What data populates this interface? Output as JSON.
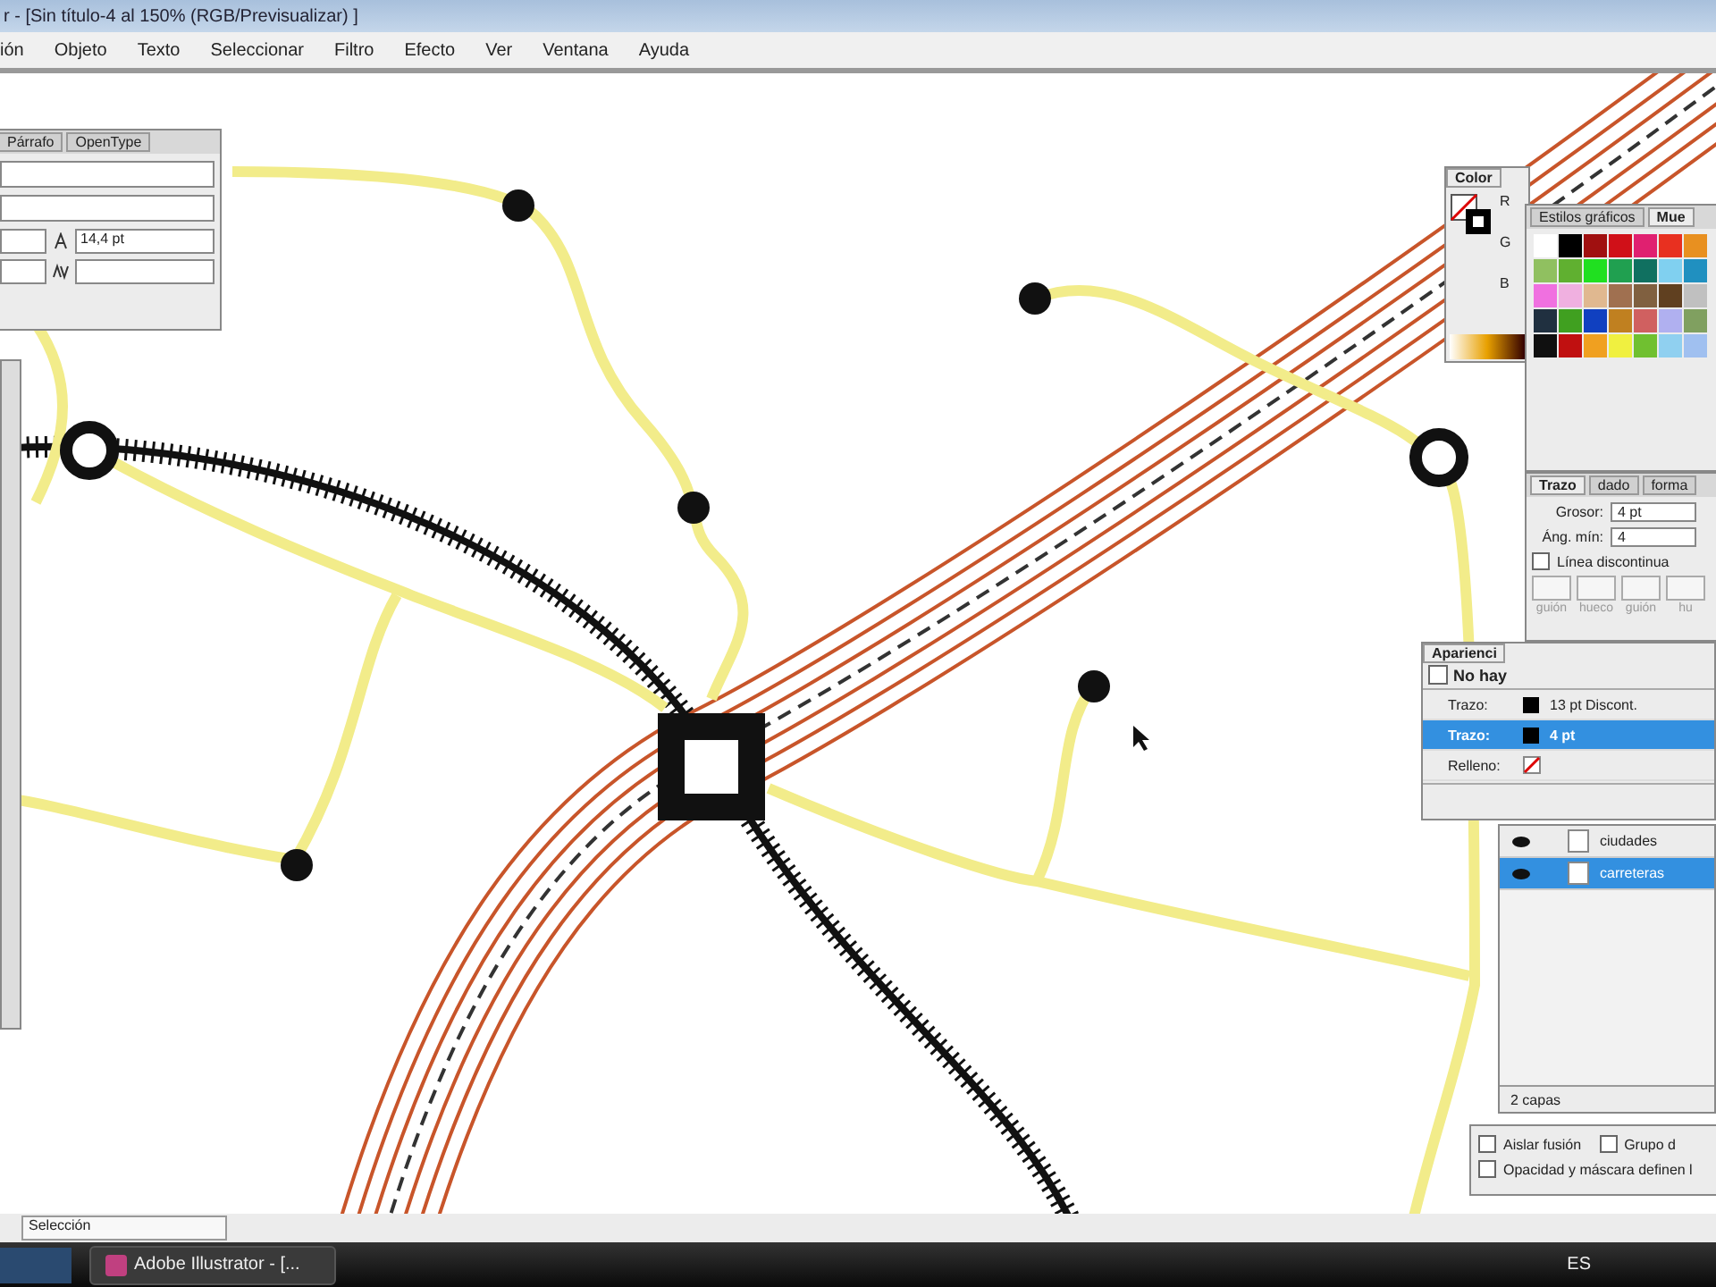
{
  "window": {
    "title": "r - [Sin título-4 al 150% (RGB/Previsualizar) ]"
  },
  "menu": [
    "ión",
    "Objeto",
    "Texto",
    "Seleccionar",
    "Filtro",
    "Efecto",
    "Ver",
    "Ventana",
    "Ayuda"
  ],
  "character_panel": {
    "tabs": [
      {
        "label": "Párrafo",
        "selected": false
      },
      {
        "label": "OpenType",
        "selected": false
      }
    ],
    "leading": "14,4 pt"
  },
  "color_panel": {
    "title": "Color",
    "channels": [
      "R",
      "G",
      "B"
    ]
  },
  "swatches_panel": {
    "tabs": [
      {
        "label": "Estilos gráficos",
        "selected": false
      },
      {
        "label": "Mue",
        "selected": true
      }
    ],
    "swatches": [
      {
        "color": "#ffffff"
      },
      {
        "color": "#000000"
      },
      {
        "color": "#a01010"
      },
      {
        "color": "#d01018"
      },
      {
        "color": "#e02070"
      },
      {
        "color": "#e83020"
      },
      {
        "color": "#e89020"
      },
      {
        "color": "#90c060"
      },
      {
        "color": "#60b030"
      },
      {
        "color": "#20e020"
      },
      {
        "color": "#20a050"
      },
      {
        "color": "#107060"
      },
      {
        "color": "#80d0f0"
      },
      {
        "color": "#2090c0"
      },
      {
        "color": "#f070e0"
      },
      {
        "color": "#f0b0e0"
      },
      {
        "color": "#e0b890"
      },
      {
        "color": "#a07050"
      },
      {
        "color": "#806040"
      },
      {
        "color": "#604020"
      },
      {
        "color": "#c0c0c0"
      },
      {
        "color": "#203040"
      },
      {
        "color": "#40a020"
      },
      {
        "color": "#1040c0"
      },
      {
        "color": "#c08020"
      },
      {
        "color": "#d06060"
      },
      {
        "color": "#b0b0f0"
      },
      {
        "color": "#80a060"
      },
      {
        "color": "#101010"
      },
      {
        "color": "#c01010"
      },
      {
        "color": "#f0a020"
      },
      {
        "color": "#f0f040"
      },
      {
        "color": "#70c030"
      },
      {
        "color": "#90d0f0"
      },
      {
        "color": "#a0c0f0"
      }
    ]
  },
  "stroke_panel": {
    "tabs": [
      {
        "label": "Trazo",
        "selected": true
      },
      {
        "label": "dado",
        "selected": false
      },
      {
        "label": "forma",
        "selected": false
      }
    ],
    "weight_label": "Grosor:",
    "weight": "4 pt",
    "miter_label": "Áng. mín:",
    "miter": "4",
    "dashed": {
      "label": "Línea discontinua",
      "checked": false
    },
    "dash_labels": [
      "guión",
      "hueco",
      "guión",
      "hu"
    ]
  },
  "appearance_panel": {
    "title": "Aparienci",
    "target": "No hay",
    "rows": [
      {
        "kind": "stroke",
        "label": "Trazo:",
        "value": "13 pt Discont.",
        "selected": false
      },
      {
        "kind": "stroke",
        "label": "Trazo:",
        "value": "4 pt",
        "selected": true
      },
      {
        "kind": "fill",
        "label": "Relleno:",
        "selected": false
      }
    ]
  },
  "layers_panel": {
    "layers": [
      {
        "name": "ciudades",
        "visible": true,
        "selected": false
      },
      {
        "name": "carreteras",
        "visible": true,
        "selected": true
      }
    ],
    "count": "2 capas"
  },
  "transparency_options": [
    {
      "label": "Aislar fusión",
      "checked": false
    },
    {
      "label": "Grupo d",
      "checked": false
    },
    {
      "label": "Opacidad y máscara definen l",
      "checked": false
    }
  ],
  "status": {
    "tool": "Selección"
  },
  "taskbar": {
    "app": "Adobe Illustrator - [...",
    "language": "ES"
  }
}
